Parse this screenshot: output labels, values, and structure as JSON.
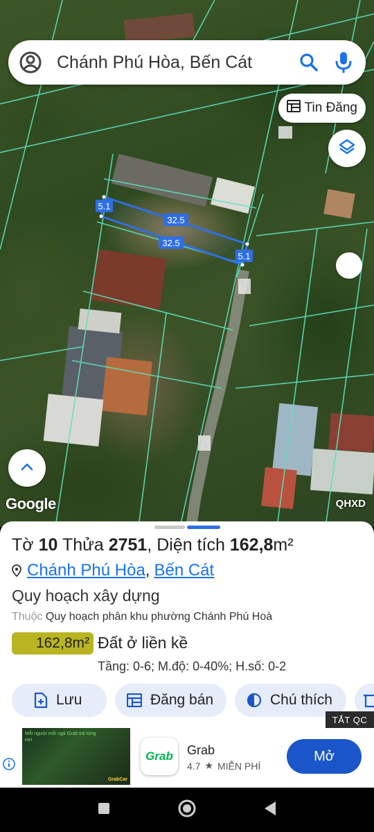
{
  "search": {
    "query": "Chánh Phú Hòa, Bến Cát"
  },
  "map": {
    "tin_dang_label": "Tin Đăng",
    "attribution": "Google",
    "layer_label": "QHXD",
    "parcel_dims": {
      "top_side": "5.1",
      "long_side_a": "32.5",
      "long_side_b": "32.5",
      "bottom_side": "5.1"
    },
    "parcel_color": "#2f6fe4",
    "boundary_color": "#5de0c0"
  },
  "parcel": {
    "title_prefix": "Tờ",
    "sheet_no": "10",
    "plot_label": "Thửa",
    "plot_no": "2751",
    "area_label": ", Diện tích",
    "area": "162,8",
    "area_unit": "m²",
    "ward": "Chánh Phú Hòa",
    "district": "Bến Cát",
    "comma": ",",
    "plan_title": "Quy hoạch xây dựng",
    "belongs_label": "Thuộc",
    "belongs_value": "Quy hoạch phân khu phường Chánh Phú Hoà",
    "zone_area": "162,8m²",
    "zone_color": "#b9b422",
    "land_type": "Đất ở liền kề",
    "specs": "Tầng: 0-6; M.độ: 0-40%; H.số: 0-2"
  },
  "actions": {
    "save": "Lưu",
    "sell": "Đăng bán",
    "legend": "Chú thích"
  },
  "ad": {
    "hide_label": "TẮT QC",
    "thumb_text": "Mỗi người mỗi ngả Grab trả từng nơi",
    "thumb_sub": "GrabCar",
    "logo_text": "Grab",
    "app_name": "Grab",
    "rating": "4.7",
    "price": "MIỄN PHÍ",
    "cta": "Mở"
  }
}
